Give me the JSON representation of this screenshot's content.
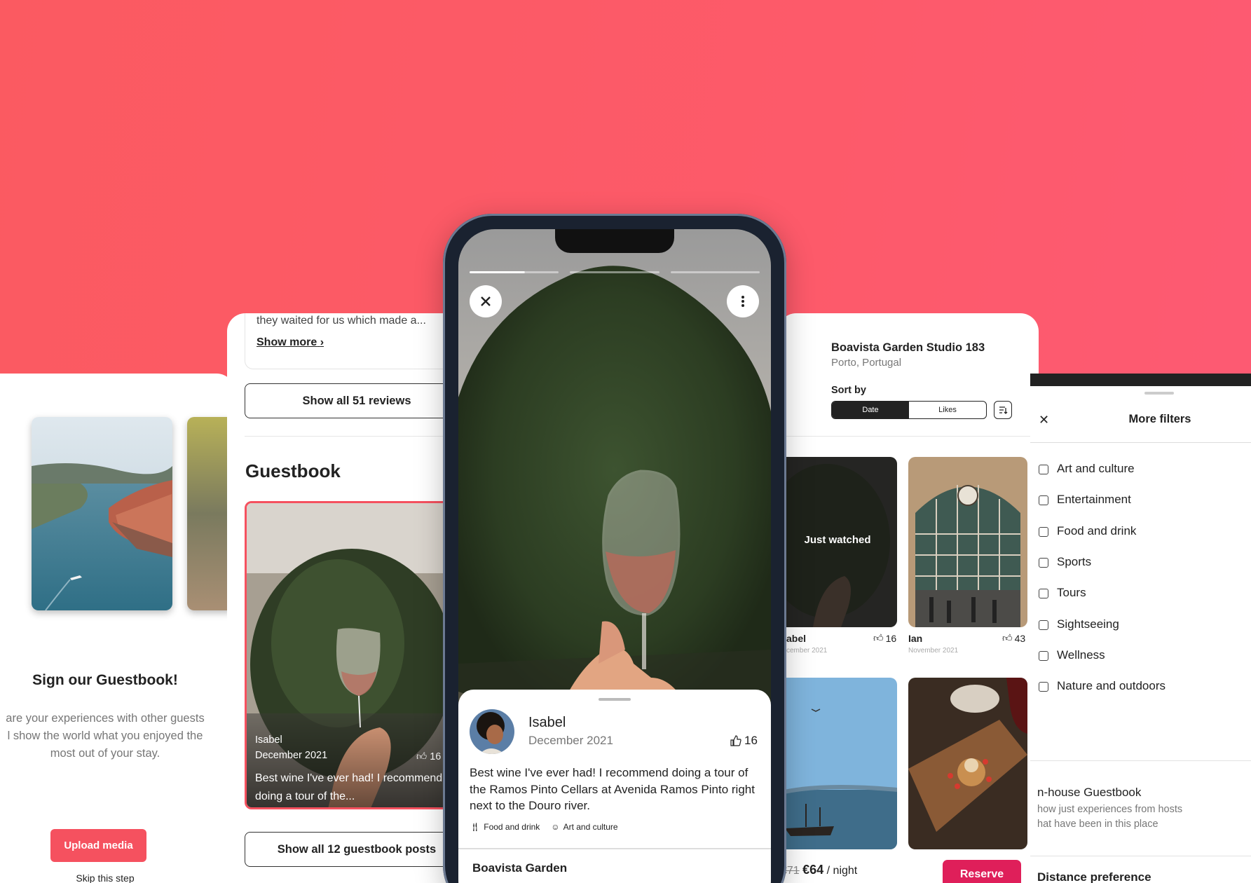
{
  "panel_signup": {
    "title": "Sign our Guestbook!",
    "description": "are your experiences with other guests\nl show the world what you enjoyed the\nmost out of your stay.",
    "upload_button": "Upload media",
    "skip_link": "Skip this step"
  },
  "panel_reviews": {
    "review_snippet": "they waited for us which made a...",
    "show_more": "Show more",
    "show_all_reviews": "Show all 51 reviews",
    "guestbook_heading": "Guestbook",
    "post": {
      "name": "Isabel",
      "date": "December 2021",
      "likes": "16",
      "text": "Best wine I've ever had! I recommend doing a tour of the..."
    },
    "show_all_posts": "Show all 12 guestbook posts"
  },
  "phone": {
    "story": {
      "progress_segments": 3,
      "progress_current": 0.62
    },
    "post": {
      "name": "Isabel",
      "date": "December 2021",
      "likes": "16",
      "text": "Best wine I've ever had! I recommend doing a tour of the Ramos Pinto Cellars at Avenida Ramos Pinto right next to the Douro river.",
      "tags": [
        "Food and drink",
        "Art and culture"
      ]
    },
    "listing_title": "Boavista Garden"
  },
  "panel_listing": {
    "title": "Boavista Garden Studio 183",
    "location": "Porto, Portugal",
    "sort_label": "Sort by",
    "sort_options": [
      "Date",
      "Likes"
    ],
    "tiles": [
      {
        "overlay": "Just watched",
        "name": "abel",
        "date": "cember 2021",
        "likes": "16"
      },
      {
        "name": "Ian",
        "date": "November 2021",
        "likes": "43"
      }
    ],
    "old_price": "€71",
    "price": "€64",
    "price_unit": "/ night",
    "reserve_button": "Reserve"
  },
  "panel_filters": {
    "title": "More filters",
    "items": [
      "Art and culture",
      "Entertainment",
      "Food and drink",
      "Sports",
      "Tours",
      "Sightseeing",
      "Wellness",
      "Nature and outdoors"
    ],
    "inhouse_title": "n-house Guestbook",
    "inhouse_desc": "how just experiences from hosts\nhat have been in this place",
    "distance_title": "Distance preference"
  },
  "colors": {
    "background": "#fd5a67",
    "accent": "#f5515f",
    "reserve": "#df1f5a"
  }
}
